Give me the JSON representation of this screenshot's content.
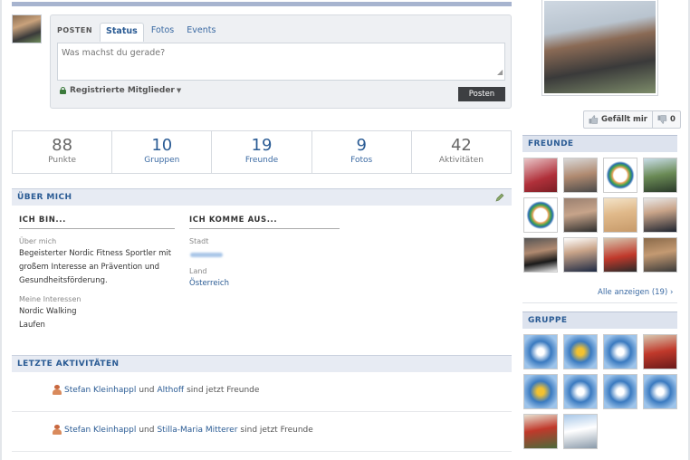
{
  "composer": {
    "label": "POSTEN",
    "tabs": [
      "Status",
      "Fotos",
      "Events"
    ],
    "placeholder": "Was machst du gerade?",
    "privacy": "Registrierte Mitglieder",
    "post_button": "Posten"
  },
  "stats": [
    {
      "value": "88",
      "label": "Punkte"
    },
    {
      "value": "10",
      "label": "Gruppen"
    },
    {
      "value": "19",
      "label": "Freunde"
    },
    {
      "value": "9",
      "label": "Fotos"
    },
    {
      "value": "42",
      "label": "Aktivitäten"
    }
  ],
  "about": {
    "title": "ÜBER MICH",
    "col1_title": "ICH BIN...",
    "col2_title": "ICH KOMME AUS...",
    "ueber_label": "Über mich",
    "ueber_text_1": "Begeisterter Nordic Fitness Sportler mit",
    "ueber_text_2": "großem Interesse an Prävention und",
    "ueber_text_3": "Gesundheitsförderung.",
    "interests_label": "Meine Interessen",
    "interest_1": "Nordic Walking",
    "interest_2": "Laufen",
    "city_label": "Stadt",
    "country_label": "Land",
    "country_value": "Österreich"
  },
  "activities": {
    "title": "LETZTE AKTIVITÄTEN",
    "items": [
      {
        "user": "Stefan Kleinhappl",
        "and": "und",
        "other": "Althoff",
        "text": "sind jetzt Freunde"
      },
      {
        "user": "Stefan Kleinhappl",
        "and": "und",
        "other": "Stilla-Maria Mitterer",
        "text": "sind jetzt Freunde"
      }
    ]
  },
  "sidebar": {
    "like_label": "Gefällt mir",
    "dislike_count": "0",
    "friends_title": "FREUNDE",
    "see_all": "Alle anzeigen (19) ›",
    "groups_title": "GRUPPE"
  },
  "colors": {
    "accent": "#2a5b94",
    "header_bg": "#e7ebf3",
    "post_button": "#3d3f42"
  }
}
